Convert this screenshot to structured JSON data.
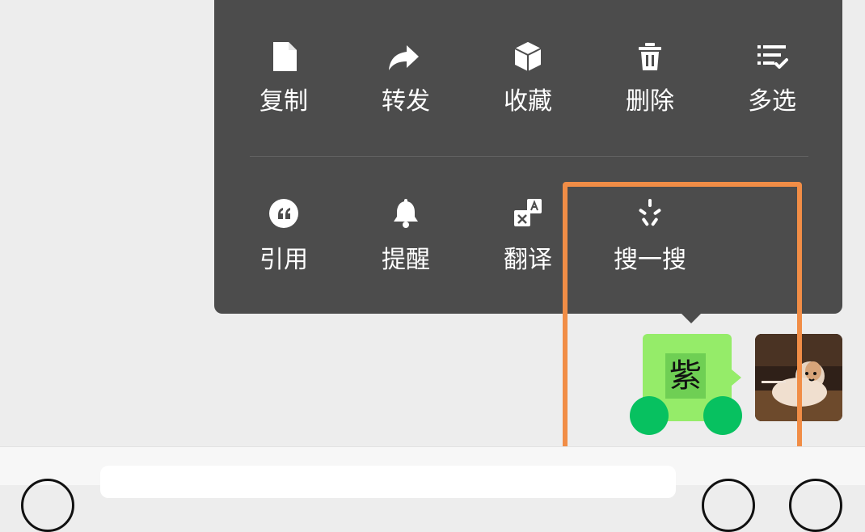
{
  "menu": {
    "items": [
      {
        "label": "复制",
        "icon": "document-icon"
      },
      {
        "label": "转发",
        "icon": "forward-arrow-icon"
      },
      {
        "label": "收藏",
        "icon": "cube-icon"
      },
      {
        "label": "删除",
        "icon": "trash-icon"
      },
      {
        "label": "多选",
        "icon": "multi-select-list-icon"
      },
      {
        "label": "引用",
        "icon": "quote-icon"
      },
      {
        "label": "提醒",
        "icon": "bell-icon"
      },
      {
        "label": "翻译",
        "icon": "translate-icon"
      },
      {
        "label": "搜一搜",
        "icon": "sparkle-search-icon"
      }
    ]
  },
  "message": {
    "text": "紫"
  },
  "colors": {
    "menu_background": "#4c4c4c",
    "bubble_green": "#95ec69",
    "selection_handle": "#07c160",
    "highlight_orange": "#f18d46",
    "chat_background": "#ededed"
  }
}
